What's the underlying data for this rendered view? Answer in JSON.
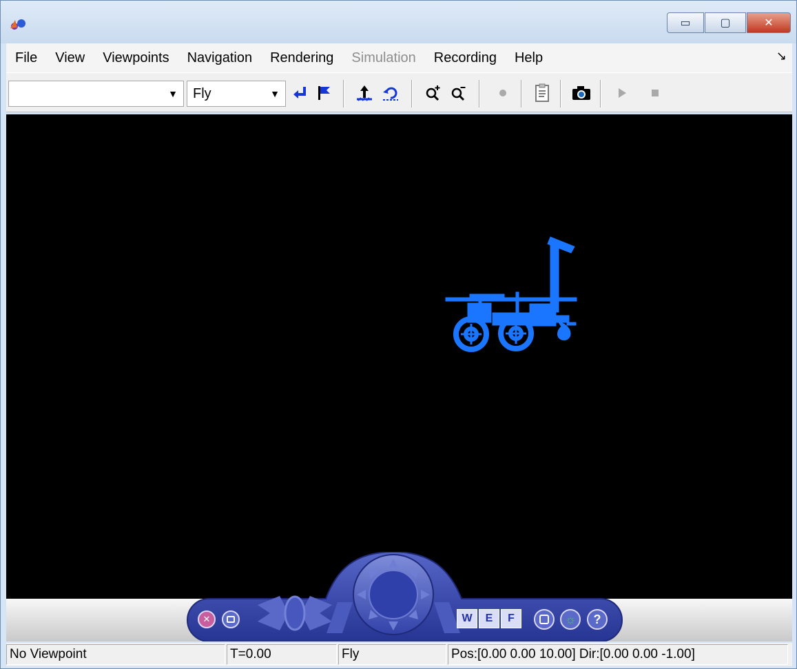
{
  "window": {
    "buttons": {
      "minimize": "▭",
      "maximize": "▢",
      "close": "✕"
    }
  },
  "menu": {
    "items": [
      {
        "label": "File",
        "enabled": true
      },
      {
        "label": "View",
        "enabled": true
      },
      {
        "label": "Viewpoints",
        "enabled": true
      },
      {
        "label": "Navigation",
        "enabled": true
      },
      {
        "label": "Rendering",
        "enabled": true
      },
      {
        "label": "Simulation",
        "enabled": false
      },
      {
        "label": "Recording",
        "enabled": true
      },
      {
        "label": "Help",
        "enabled": true
      }
    ],
    "extra_icon": "↘"
  },
  "toolbar": {
    "viewpoint_select": {
      "value": "",
      "arrow": "▼"
    },
    "navigation_select": {
      "value": "Fly",
      "arrow": "▼"
    },
    "icons": [
      "return-to-viewpoint-icon",
      "flag-icon",
      "straighten-up-icon",
      "undo-move-icon",
      "zoom-in-icon",
      "zoom-out-icon",
      "record-icon",
      "clipboard-icon",
      "camera-icon",
      "play-icon",
      "stop-icon"
    ],
    "accent_color": "#1637d8"
  },
  "scene": {
    "background_color": "#000000",
    "object_color": "#1a76ff",
    "object": "rover"
  },
  "navigation_panel": {
    "labels": {
      "w": "W",
      "e": "E",
      "f": "F",
      "help": "?"
    },
    "panel_color": "#3242a8",
    "highlight_color": "#49c84d"
  },
  "status": {
    "viewpoint": "No Viewpoint",
    "time": "T=0.00",
    "mode": "Fly",
    "position": "Pos:[0.00 0.00 10.00] Dir:[0.00 0.00 -1.00]"
  }
}
